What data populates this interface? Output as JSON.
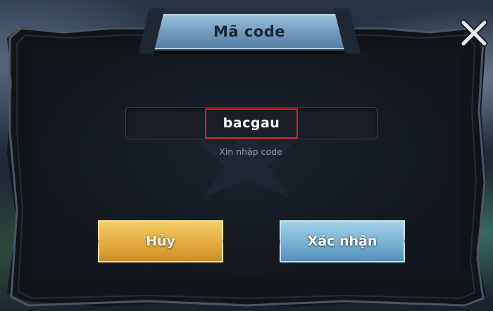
{
  "dialog": {
    "title": "Mã code",
    "code_input": {
      "value": "bacgau",
      "highlight_color": "#e01c1c"
    },
    "hint": "Xin nhập code",
    "close_icon": "close-x-icon",
    "buttons": {
      "cancel_label": "Hủy",
      "confirm_label": "Xác nhận"
    }
  },
  "colors": {
    "cancel_button": "#e3a93c",
    "confirm_button": "#72acd0",
    "title_plate": "#7aa3c4"
  }
}
